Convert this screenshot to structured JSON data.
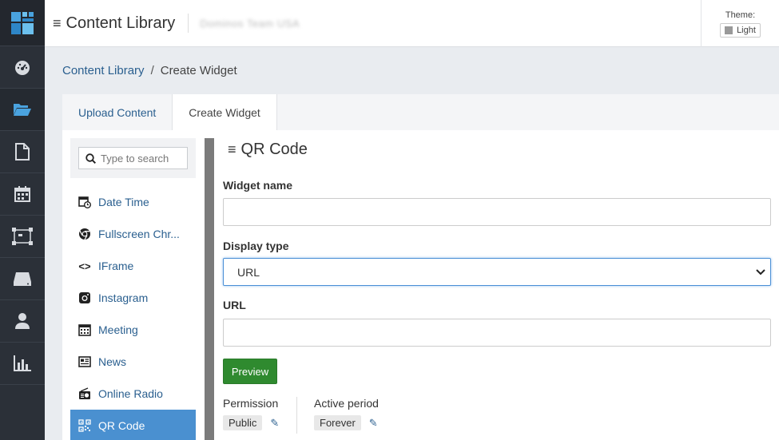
{
  "header": {
    "title": "Content Library",
    "team": "Dominos Team USA",
    "theme_label": "Theme:",
    "theme_value": "Light"
  },
  "rail": {
    "icons": [
      "dashboard-icon",
      "folder-open-icon",
      "file-icon",
      "calendar-icon",
      "layout-icon",
      "display-icon",
      "user-icon",
      "chart-icon"
    ],
    "active": "folder-open-icon"
  },
  "breadcrumb": {
    "parent": "Content Library",
    "separator": "/",
    "current": "Create Widget"
  },
  "tabs": [
    {
      "label": "Upload Content",
      "active": false
    },
    {
      "label": "Create Widget",
      "active": true
    }
  ],
  "widget_search": {
    "placeholder": "Type to search"
  },
  "widgets": [
    {
      "label": "Date Time",
      "icon": "calendar-clock-icon"
    },
    {
      "label": "Fullscreen Chr...",
      "icon": "chrome-icon"
    },
    {
      "label": "IFrame",
      "icon": "code-icon"
    },
    {
      "label": "Instagram",
      "icon": "instagram-icon"
    },
    {
      "label": "Meeting",
      "icon": "meeting-calendar-icon"
    },
    {
      "label": "News",
      "icon": "newspaper-icon"
    },
    {
      "label": "Online Radio",
      "icon": "radio-icon"
    },
    {
      "label": "QR Code",
      "icon": "qr-code-icon",
      "active": true
    }
  ],
  "form": {
    "title": "QR Code",
    "widget_name_label": "Widget name",
    "widget_name_value": "",
    "display_type_label": "Display type",
    "display_type_value": "URL",
    "url_label": "URL",
    "url_value": "",
    "preview_label": "Preview",
    "permission_label": "Permission",
    "permission_value": "Public",
    "active_period_label": "Active period",
    "active_period_value": "Forever"
  },
  "colors": {
    "accent": "#4a90d0",
    "preview": "#2f8a2f",
    "rail": "#2b3038",
    "link": "#2a5f8f"
  }
}
